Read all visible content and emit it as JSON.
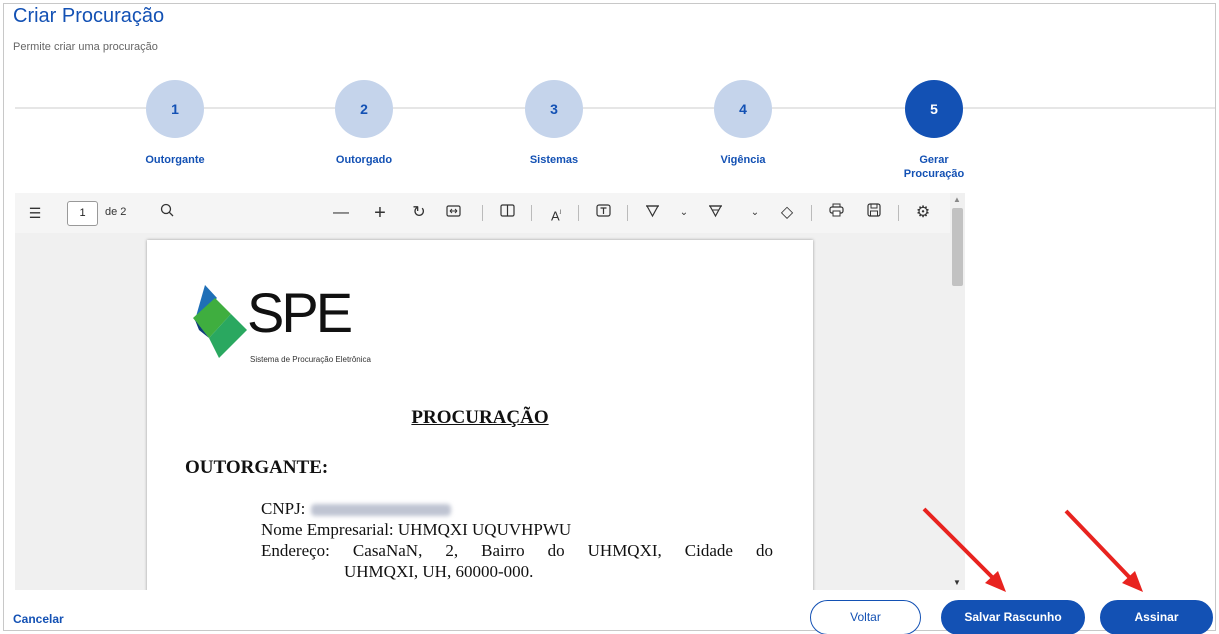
{
  "header": {
    "title": "Criar Procuração",
    "subtitle": "Permite criar uma procuração"
  },
  "steps": [
    {
      "number": "1",
      "label": "Outorgante",
      "active": false
    },
    {
      "number": "2",
      "label": "Outorgado",
      "active": false
    },
    {
      "number": "3",
      "label": "Sistemas",
      "active": false
    },
    {
      "number": "4",
      "label": "Vigência",
      "active": false
    },
    {
      "number": "5",
      "label": "Gerar Procuração",
      "active": true
    }
  ],
  "viewer": {
    "current_page": "1",
    "page_of": "de 2",
    "icons": [
      "contents-icon",
      "search-icon",
      "zoom-out-icon",
      "zoom-in-icon",
      "rotate-icon",
      "fit-width-icon",
      "page-view-icon",
      "read-aloud-icon",
      "text-icon",
      "draw-icon",
      "chevron-down-icon",
      "highlight-icon",
      "chevron-down-icon",
      "eraser-icon",
      "print-icon",
      "save-icon",
      "settings-icon"
    ]
  },
  "document": {
    "logo_text": "SPE",
    "logo_subtitle": "Sistema de Procuração Eletrônica",
    "heading": "PROCURAÇÃO",
    "section": "OUTORGANTE:",
    "cnpj_label": "CNPJ:",
    "nome_label": "Nome Empresarial: UHMQXI UQUVHPWU",
    "endereco_line1": "Endereço: CasaNaN, 2, Bairro do UHMQXI, Cidade do",
    "endereco_line2": "UHMQXI, UH, 60000-000."
  },
  "footer": {
    "cancel_label": "Cancelar",
    "back_label": "Voltar",
    "save_draft_label": "Salvar Rascunho",
    "sign_label": "Assinar"
  },
  "colors": {
    "primary": "#1351b4",
    "step_inactive": "#c5d4eb",
    "annotation_arrow": "#e8231f",
    "logo_blue": "#1f6fb7",
    "logo_green": "#3fae3f"
  }
}
